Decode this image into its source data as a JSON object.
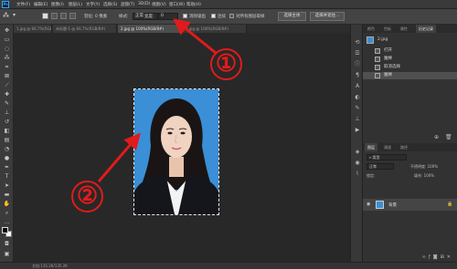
{
  "app": {
    "logo": "Ps"
  },
  "menu": [
    "文件(F)",
    "编辑(E)",
    "图像(I)",
    "图层(L)",
    "文字(Y)",
    "选择(S)",
    "滤镜(T)",
    "3D(D)",
    "视图(V)",
    "窗口(W)",
    "帮助(H)"
  ],
  "options": {
    "feather_label": "羽化: 0 像素",
    "style_label": "样式:",
    "style_value": "正常",
    "width_label": "宽度:",
    "width_value": "0",
    "antialias_label": "消除锯齿",
    "snap_label": "连续",
    "sample_all_label": "对所有图层取样",
    "select_subject_button": "选择主体",
    "select_mask_button": "选择并遮住..."
  },
  "tabs": [
    {
      "label": "1.jpg @ 66.7%(RGB/8#)",
      "active": false
    },
    {
      "label": "未标题-1 @ 66.7%(RGB/8#)",
      "active": false
    },
    {
      "label": "2.jpg @ 100%(RGB/8#)",
      "active": true
    },
    {
      "label": "3.jpg @ 100%(RGB/8#)",
      "active": false
    }
  ],
  "status": {
    "text": "文档:135.2K/135.2K"
  },
  "panels": {
    "top_tabs": [
      "颜色",
      "色板",
      "属性",
      "历史记录"
    ],
    "top_active": "历史记录",
    "history_title": "2.jpg",
    "history": [
      {
        "label": "打开",
        "selected": false
      },
      {
        "label": "魔棒",
        "selected": false
      },
      {
        "label": "取消选择",
        "selected": false
      },
      {
        "label": "魔棒",
        "selected": true
      }
    ],
    "layer_tabs": [
      "图层",
      "通道",
      "路径"
    ],
    "layer_active": "图层",
    "blend_mode": "正常",
    "opacity_label": "不透明度: 100%",
    "lock_label": "锁定:",
    "fill_label": "填充: 100%",
    "layers": [
      {
        "name": "背景"
      }
    ]
  },
  "annotations": [
    {
      "number": "①",
      "color": "#e11b1b"
    },
    {
      "number": "②",
      "color": "#e11b1b"
    }
  ],
  "colors": {
    "accent": "#31a8ff",
    "photo_bg": "#3a8fd6",
    "annotation": "#e11b1b"
  }
}
